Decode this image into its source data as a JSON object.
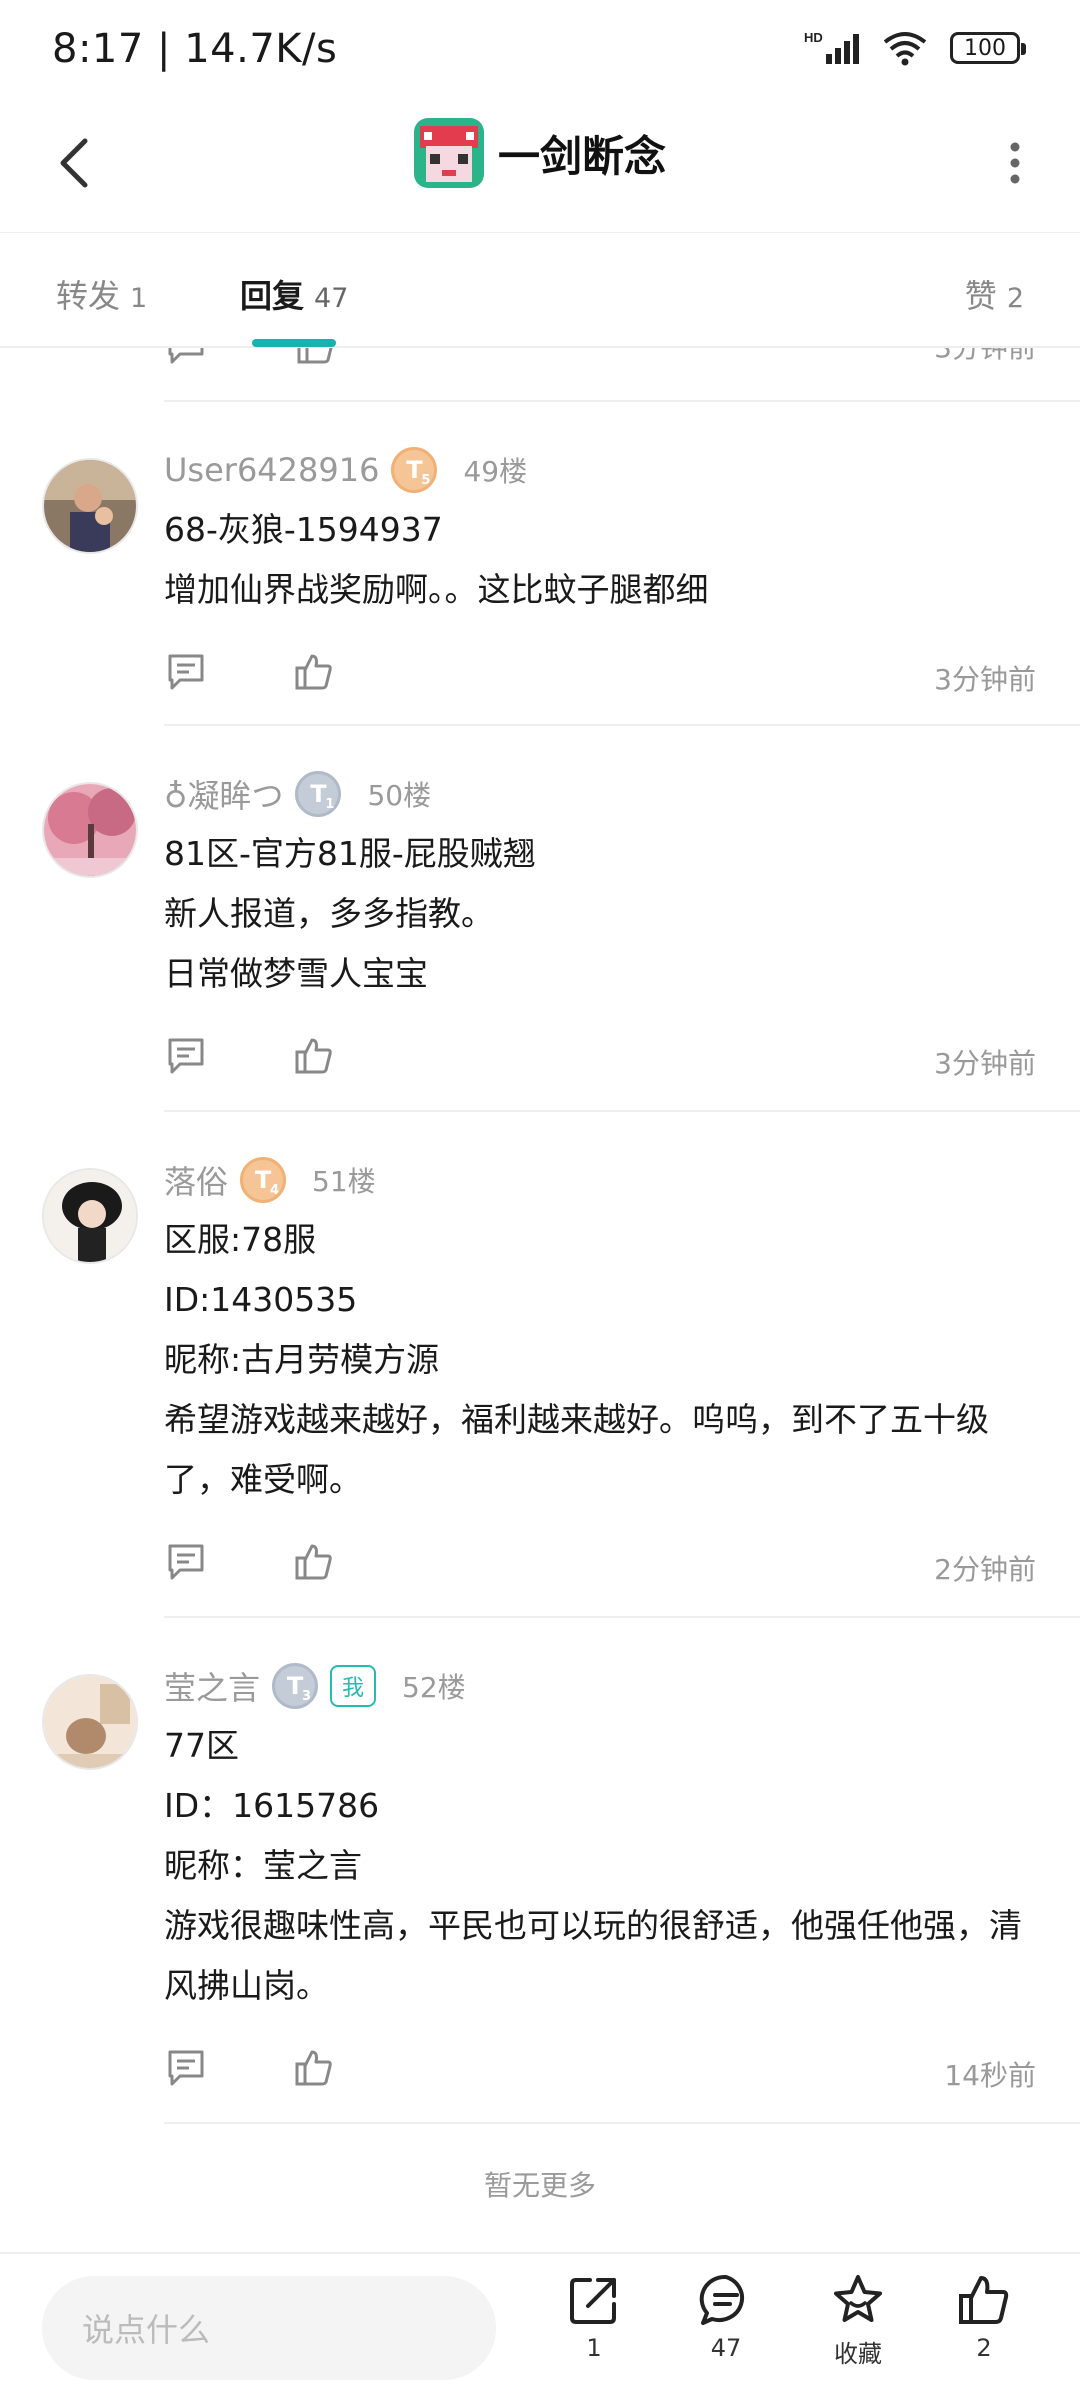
{
  "status": {
    "time": "8:17 | 14.7K/s",
    "battery": "100",
    "network_label": "HD"
  },
  "header": {
    "title": "一剑断念"
  },
  "tabs": [
    {
      "label": "转发",
      "count": "1"
    },
    {
      "label": "回复",
      "count": "47"
    },
    {
      "label": "赞",
      "count": "2"
    }
  ],
  "partial_comment": {
    "time": "3分钟前"
  },
  "comments": [
    {
      "username": "User6428916",
      "level": "T",
      "level_num": "5",
      "floor": "49楼",
      "lines": [
        "68-灰狼-1594937",
        "增加仙界战奖励啊。。这比蚊子腿都细"
      ],
      "time": "3分钟前"
    },
    {
      "username": "♁凝眸つ",
      "level": "T",
      "level_num": "1",
      "floor": "50楼",
      "lines": [
        "81区-官方81服-屁股贼翘",
        "新人报道，多多指教。",
        "日常做梦雪人宝宝"
      ],
      "time": "3分钟前"
    },
    {
      "username": "落俗",
      "level": "T",
      "level_num": "4",
      "floor": "51楼",
      "lines": [
        "区服:78服",
        "ID:1430535",
        "昵称:古月劳模方源",
        "希望游戏越来越好，福利越来越好。呜呜，到不了五十级",
        "了，难受啊。"
      ],
      "time": "2分钟前"
    },
    {
      "username": "莹之言",
      "level": "T",
      "level_num": "3",
      "badge": "我",
      "floor": "52楼",
      "lines": [
        "77区",
        "ID：1615786",
        "昵称：莹之言",
        "游戏很趣味性高，平民也可以玩的很舒适，他强任他强，清",
        "风拂山岗。"
      ],
      "time": "14秒前"
    }
  ],
  "end_note": "暂无更多",
  "bottom": {
    "input_placeholder": "说点什么",
    "share_count": "1",
    "comment_count": "47",
    "favorite_label": "收藏",
    "like_count": "2"
  },
  "colors": {
    "accent": "#17b3b0",
    "muted_text": "#9a9a9a",
    "level_gold": "#f5c596",
    "level_silver": "#c3ccd7"
  }
}
